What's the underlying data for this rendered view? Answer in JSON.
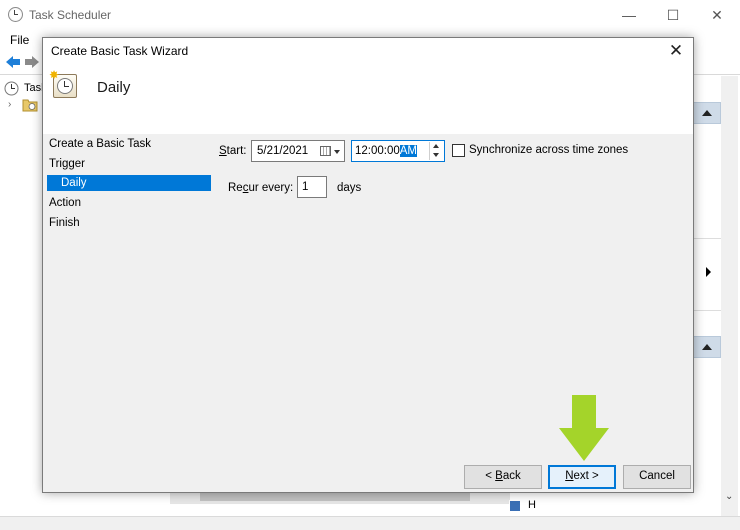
{
  "main_window": {
    "title": "Task Scheduler",
    "controls": {
      "minimize": "—",
      "maximize": "☐",
      "close": "✕"
    },
    "menu": {
      "file": "File"
    },
    "tree": {
      "root_label": "Task"
    },
    "status_partial": "H "
  },
  "dialog": {
    "title": "Create Basic Task Wizard",
    "close_glyph": "✕",
    "header_title": "Daily",
    "steps": [
      {
        "label": "Create a Basic Task"
      },
      {
        "label": "Trigger"
      },
      {
        "label": "Daily"
      },
      {
        "label": "Action"
      },
      {
        "label": "Finish"
      }
    ],
    "start_label_first": "S",
    "start_label_rest": "tart:",
    "start_date": "5/21/2021",
    "start_time_main": "12:00:00",
    "start_time_ampm": "AM",
    "sync_label": "Synchronize across time zones",
    "recur_label_pre": "Re",
    "recur_label_u": "c",
    "recur_label_post": "ur every:",
    "recur_value": "1",
    "recur_unit": "days",
    "buttons": {
      "back_pre": "< ",
      "back_u": "B",
      "back_post": "ack",
      "next_u": "N",
      "next_post": "ext >",
      "cancel": "Cancel"
    }
  },
  "colors": {
    "accent": "#0078d7",
    "annotation_arrow": "#a4d42a"
  }
}
